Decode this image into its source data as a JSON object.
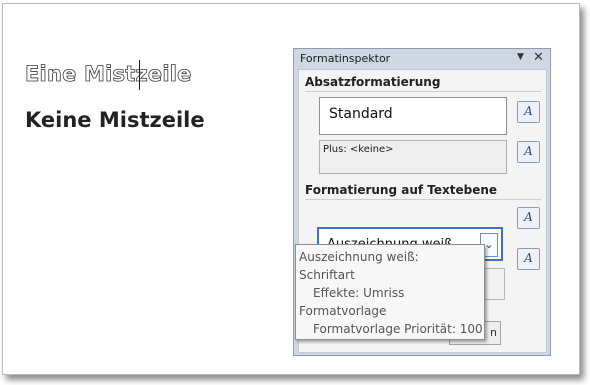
{
  "document": {
    "outline_line": "Eine Mistzeile",
    "bold_line": "Keine Mistzeile"
  },
  "panel": {
    "title": "Formatinspektor",
    "paragraph_section": {
      "heading": "Absatzformatierung",
      "style_name": "Standard",
      "plus_text": "Plus: <keine>"
    },
    "text_section": {
      "heading": "Formatierung auf Textebene",
      "selected_style": "Auszeichnung weiß"
    },
    "button_fragment": "n"
  },
  "tooltip": {
    "lines": [
      "Auszeichnung weiß:",
      "Schriftart",
      "Effekte:  Umriss",
      "Formatvorlage",
      "Formatvorlage Priorität: 100"
    ]
  },
  "colors": {
    "panel_bg": "#cfd7e3",
    "combo_border": "#3c73c8"
  },
  "icons": {
    "edit": "pencil-format-icon",
    "dropdown": "chevron-down-icon",
    "close": "close-icon"
  }
}
